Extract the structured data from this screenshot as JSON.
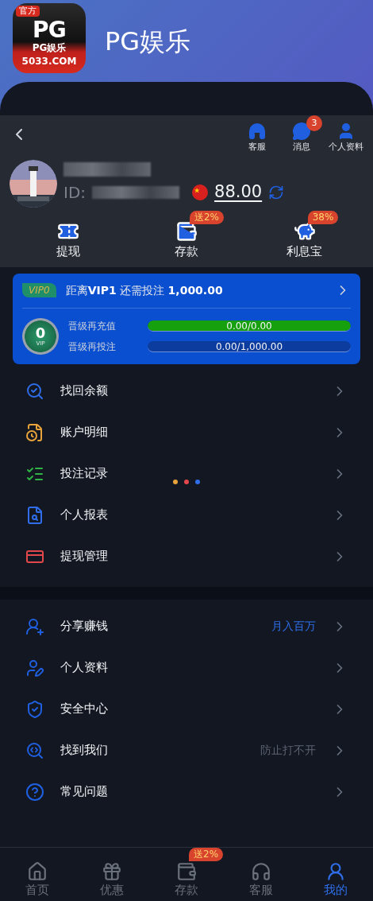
{
  "app": {
    "icon_badge": "官方",
    "icon_monogram": "PG",
    "icon_name": "PG娱乐",
    "icon_domain": "5033.COM",
    "title": "PG娱乐"
  },
  "top_actions": [
    {
      "label": "客服"
    },
    {
      "label": "消息",
      "badge": "3"
    },
    {
      "label": "个人资料"
    }
  ],
  "profile": {
    "id_label": "ID:",
    "balance": "88.00"
  },
  "quick_actions": [
    {
      "label": "提现"
    },
    {
      "label": "存款",
      "tag": "送2%"
    },
    {
      "label": "利息宝",
      "tag": "38%"
    }
  ],
  "vip": {
    "level_badge": "VIP0",
    "medal": "0",
    "medal_caption": "VIP",
    "prefix": "距离",
    "next_level": "VIP1",
    "need_text": "还需投注",
    "need_amount": "1,000.00",
    "progress": [
      {
        "label": "晋级再充值",
        "reading": "0.00/0.00",
        "level": 1
      },
      {
        "label": "晋级再投注",
        "reading": "0.00/1,000.00",
        "level": 0
      }
    ]
  },
  "menu_1": [
    {
      "label": "找回余额",
      "color": "#2f6ee8"
    },
    {
      "label": "账户明细",
      "color": "#e8a33a"
    },
    {
      "label": "投注记录",
      "color": "#2fb344"
    },
    {
      "label": "个人报表",
      "color": "#2f6ee8"
    },
    {
      "label": "提现管理",
      "color": "#e2474b"
    }
  ],
  "menu_2": [
    {
      "label": "分享赚钱",
      "note": "月入百万",
      "kind": "highlight"
    },
    {
      "label": "个人资料"
    },
    {
      "label": "安全中心"
    },
    {
      "label": "找到我们",
      "note": "防止打不开",
      "kind": "muted"
    },
    {
      "label": "常见问题"
    }
  ],
  "bottom_nav": [
    {
      "label": "首页",
      "selected": false
    },
    {
      "label": "优惠",
      "selected": false
    },
    {
      "label": "存款",
      "selected": false,
      "tag": "送2%"
    },
    {
      "label": "客服",
      "selected": false
    },
    {
      "label": "我的",
      "selected": true
    }
  ]
}
